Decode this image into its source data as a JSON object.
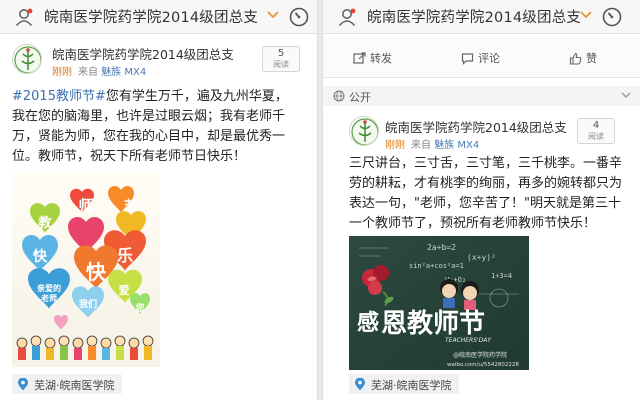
{
  "left": {
    "header": {
      "title": "皖南医学院药学院2014级团总支"
    },
    "post": {
      "account_name": "皖南医学院药学院2014级团总支",
      "time": "刚刚",
      "via": "来自",
      "device": "魅族 MX4",
      "views": {
        "count": "5",
        "label": "阅读"
      },
      "hashtag": "#2015教师节#",
      "lines": [
        "您有学生万千，遍及九州华夏，",
        "我在您的脑海里，也许是过眼云烟；我有老师千",
        "万，贤能为师，您在我的心目中，却是最优秀一",
        "位。教师节，祝天下所有老师节日快乐！"
      ],
      "image": {
        "chars": [
          "教",
          "师",
          "节",
          "快",
          "快",
          "乐",
          "亲爱的",
          "老师",
          "我们",
          "爱",
          "您"
        ]
      },
      "location": "芜湖·皖南医学院"
    }
  },
  "right": {
    "header": {
      "title": "皖南医学院药学院2014级团总支"
    },
    "actions": {
      "repost": "转发",
      "comment": "评论",
      "like": "赞"
    },
    "visibility": "公开",
    "post": {
      "account_name": "皖南医学院药学院2014级团总支",
      "time": "刚刚",
      "via": "来自",
      "device": "魅族 MX4",
      "views": {
        "count": "4",
        "label": "阅读"
      },
      "lines": [
        "三尺讲台，三寸舌，三寸笔，三千桃李。一番辛",
        "劳的耕耘，才有桃李的绚丽，再多的婉转都只为",
        "表达一句，\"老师，您辛苦了！\"明天就是第三十",
        "一个教师节了，预祝所有老师教师节快乐！"
      ],
      "image": {
        "big_title": "恩教师节",
        "gan": "感",
        "subtitle": "TEACHERS'DAY",
        "formulas": [
          "2a+b=2",
          "(x+y)²",
          "sin²a+cos²a=1",
          "1+3=4",
          "H₂+O₂"
        ],
        "watermark": "@皖南医学院药学院",
        "watermark_url": "weibo.com/u/5542802228"
      },
      "location": "芜湖·皖南医学院"
    }
  },
  "colors": {
    "link_blue": "#3c6fb0",
    "time_orange": "#e07a18",
    "device_blue": "#4a7bb5",
    "chevron_orange": "#e8943a"
  }
}
